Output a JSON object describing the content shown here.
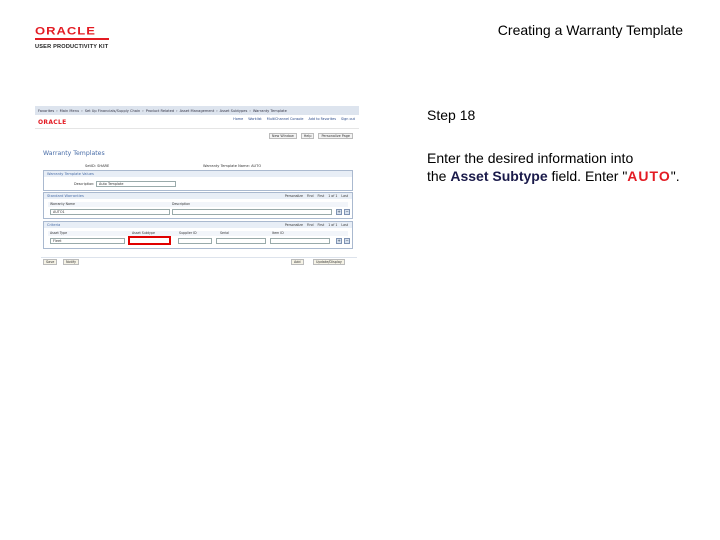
{
  "header": {
    "logo_oracle": "ORACLE",
    "logo_sub": "USER PRODUCTIVITY KIT",
    "title": "Creating a Warranty Template"
  },
  "screenshot": {
    "nav": [
      "Favorites",
      "Main Menu",
      "Set Up Financials/Supply Chain",
      "Product Related",
      "Asset Management",
      "Asset Subtypes",
      "Warranty Template"
    ],
    "brand": "ORACLE",
    "brand_links": [
      "Home",
      "Worklist",
      "MultiChannel Console",
      "Add to Favorites",
      "Sign out"
    ],
    "toolbar": [
      "New Window",
      "Help",
      "Personalize Page"
    ],
    "page_title": "Warranty Templates",
    "setid": "SetID: SHARE",
    "template_id": "Warranty Template Name: AUTO",
    "section1_title": "Warranty Template Values",
    "description_label": "Description:",
    "description_value": "Auto Template",
    "section2_title": "Standard Warranties",
    "section2_controls": [
      "Personalize",
      "Find",
      "First",
      "1 of 1",
      "Last"
    ],
    "section2_cols": [
      "Warranty Name",
      "Description"
    ],
    "warranty_value": "AUTO1",
    "section3_title": "Criteria",
    "section3_controls": [
      "Personalize",
      "Find",
      "First",
      "1 of 1",
      "Last"
    ],
    "section3_cols": [
      "Asset Type",
      "Asset Subtype",
      "Supplier ID",
      "Serial",
      "Item ID"
    ],
    "asset_type_value": "Fleet",
    "buttons_left": [
      "Save",
      "Notify"
    ],
    "buttons_right": [
      "Add",
      "Update/Display"
    ]
  },
  "instructions": {
    "step": "Step 18",
    "line1": "Enter the desired information into",
    "pre": "the ",
    "field": "Asset Subtype",
    "mid": " field. Enter \"",
    "value": "AUTO",
    "post": "\"."
  }
}
